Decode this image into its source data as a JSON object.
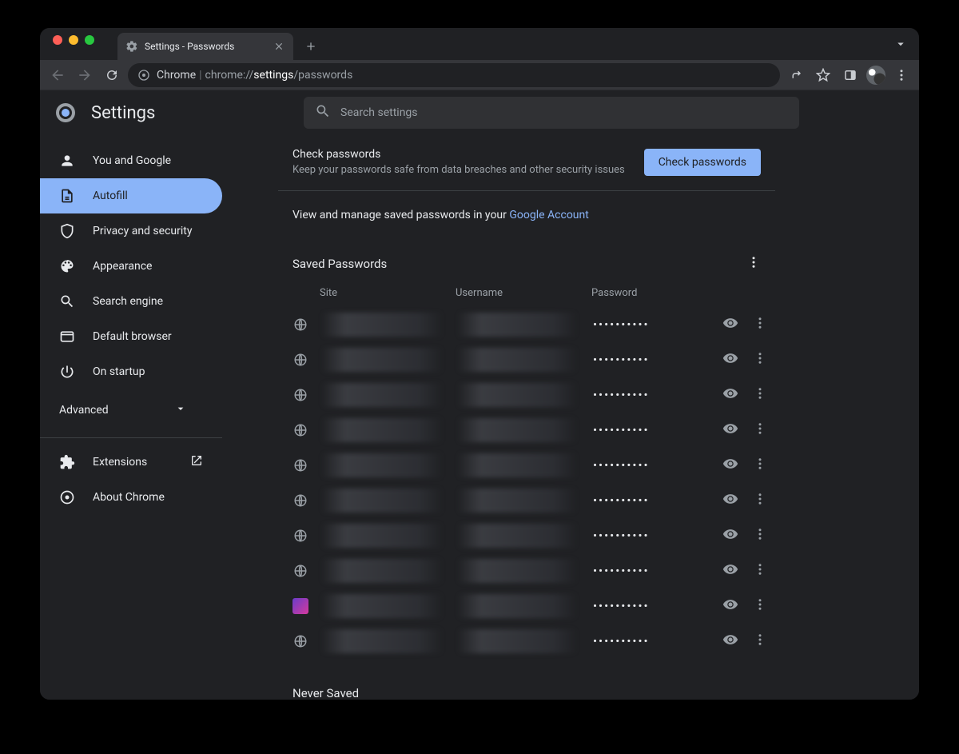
{
  "tab": {
    "title": "Settings - Passwords"
  },
  "omnibox": {
    "product": "Chrome",
    "sep": " | ",
    "prefix": "chrome://",
    "strong": "settings",
    "suffix": "/passwords"
  },
  "page": {
    "title": "Settings",
    "search_placeholder": "Search settings"
  },
  "sidebar": {
    "items": [
      {
        "label": "You and Google"
      },
      {
        "label": "Autofill"
      },
      {
        "label": "Privacy and security"
      },
      {
        "label": "Appearance"
      },
      {
        "label": "Search engine"
      },
      {
        "label": "Default browser"
      },
      {
        "label": "On startup"
      }
    ],
    "advanced": "Advanced",
    "extensions": "Extensions",
    "about": "About Chrome"
  },
  "check": {
    "title": "Check passwords",
    "subtitle": "Keep your passwords safe from data breaches and other security issues",
    "button": "Check passwords"
  },
  "manage": {
    "prefix": "View and manage saved passwords in your ",
    "link": "Google Account"
  },
  "saved": {
    "heading": "Saved Passwords",
    "columns": {
      "site": "Site",
      "username": "Username",
      "password": "Password"
    },
    "rows": [
      {
        "mask": "••••••••••",
        "favicon": "globe"
      },
      {
        "mask": "••••••••••",
        "favicon": "globe"
      },
      {
        "mask": "••••••••••",
        "favicon": "globe"
      },
      {
        "mask": "••••••••••",
        "favicon": "globe"
      },
      {
        "mask": "••••••••••",
        "favicon": "globe"
      },
      {
        "mask": "••••••••••",
        "favicon": "globe"
      },
      {
        "mask": "••••••••••",
        "favicon": "globe"
      },
      {
        "mask": "••••••••••",
        "favicon": "globe"
      },
      {
        "mask": "••••••••••",
        "favicon": "square"
      },
      {
        "mask": "••••••••••",
        "favicon": "globe"
      }
    ]
  },
  "never": {
    "heading": "Never Saved"
  }
}
